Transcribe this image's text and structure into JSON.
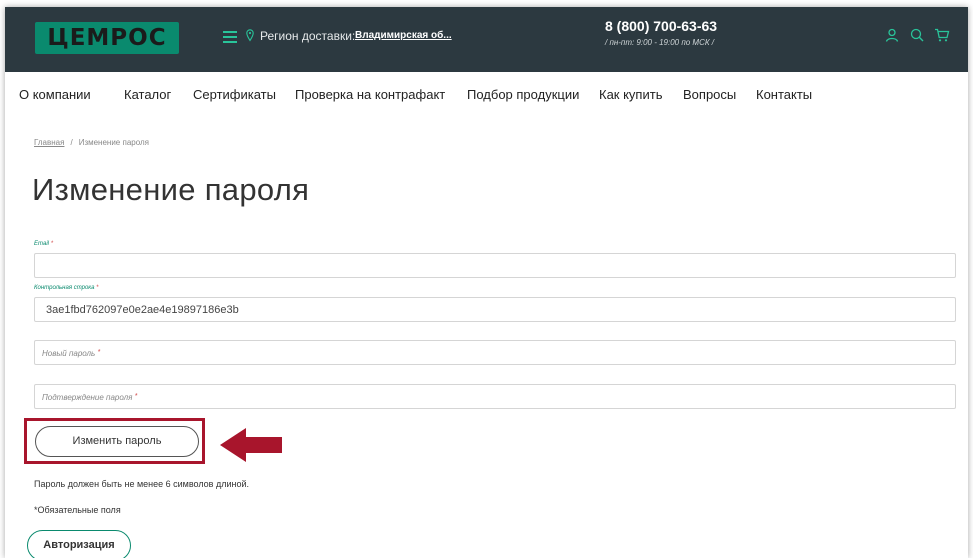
{
  "header": {
    "logo_text": "ЦЕМРОС",
    "region_label": "Регион доставки:",
    "region_value": "Владимирская об...",
    "phone": "8 (800) 700-63-63",
    "hours": "/ пн-пт: 9:00 - 19:00 по МСК /",
    "icons": [
      "menu-icon",
      "location-pin-icon",
      "user-icon",
      "search-icon",
      "cart-icon"
    ]
  },
  "nav": {
    "items": [
      "О компании",
      "Каталог",
      "Сертификаты",
      "Проверка на контрафакт",
      "Подбор продукции",
      "Как купить",
      "Вопросы",
      "Контакты"
    ]
  },
  "breadcrumb": {
    "home": "Главная",
    "separator": "/",
    "current": "Изменение пароля"
  },
  "page": {
    "title": "Изменение пароля"
  },
  "form": {
    "email_label": "Email",
    "email_value": "",
    "checkword_label": "Контрольная строка",
    "checkword_value": "3ae1fbd762097e0e2ae4e19897186e3b",
    "new_password_placeholder": "Новый пароль",
    "confirm_password_placeholder": "Подтверждение пароля",
    "required_mark": "*",
    "submit_label": "Изменить пароль",
    "password_note": "Пароль должен быть не менее 6 символов длиной.",
    "required_note": "*Обязательные поля",
    "auth_label": "Авторизация"
  },
  "colors": {
    "header_bg": "#2c3940",
    "brand_green": "#0a8a6e",
    "accent_teal": "#29c49a",
    "highlight_red": "#a8152c"
  }
}
